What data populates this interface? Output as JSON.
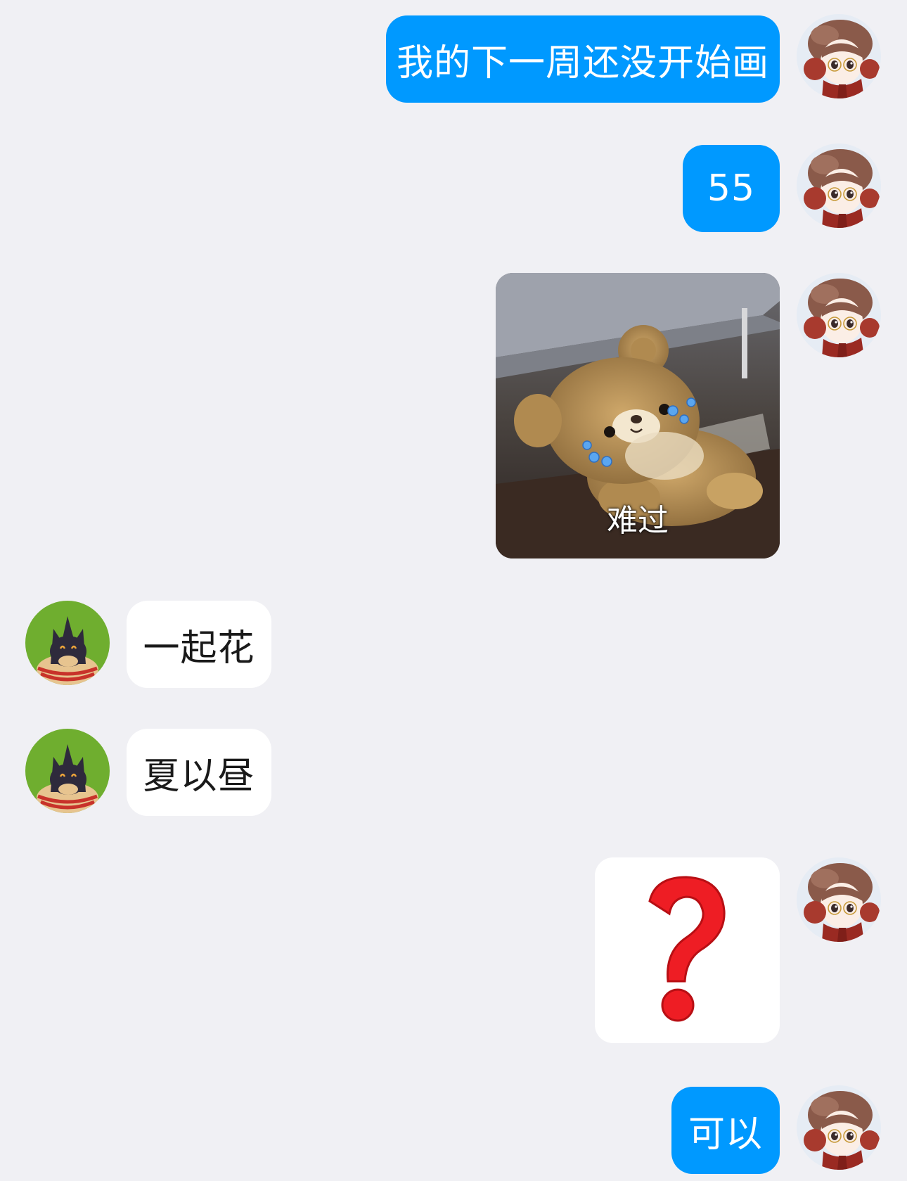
{
  "chat": {
    "messages": [
      {
        "sender": "me",
        "type": "text",
        "text": "我的下一周还没开始画"
      },
      {
        "sender": "me",
        "type": "text",
        "text": "55"
      },
      {
        "sender": "me",
        "type": "sticker",
        "caption": "难过",
        "icon": "crying-teddy-bear-sticker"
      },
      {
        "sender": "friend",
        "type": "text",
        "text": "一起花"
      },
      {
        "sender": "friend",
        "type": "text",
        "text": "夏以昼"
      },
      {
        "sender": "me",
        "type": "sticker",
        "icon": "red-question-mark-sticker"
      },
      {
        "sender": "me",
        "type": "text",
        "text": "可以"
      }
    ]
  },
  "colors": {
    "outgoing_bubble": "#0099ff",
    "incoming_bubble": "#ffffff",
    "background": "#f0f0f4"
  }
}
